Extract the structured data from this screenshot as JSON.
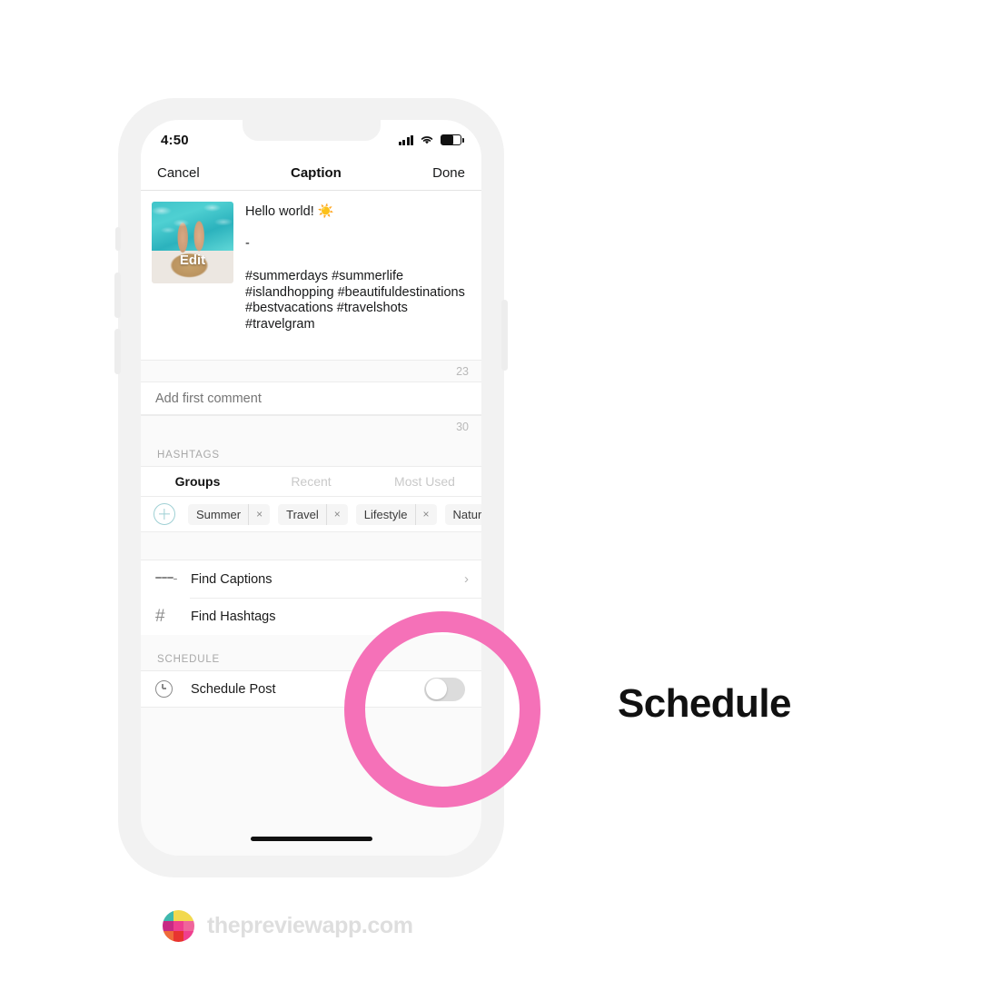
{
  "status_bar": {
    "time": "4:50",
    "icons": [
      "signal-icon",
      "wifi-icon",
      "battery-icon"
    ],
    "battery_level_pct": 60
  },
  "nav_bar": {
    "cancel_label": "Cancel",
    "title": "Caption",
    "done_label": "Done"
  },
  "caption": {
    "thumbnail_overlay_label": "Edit",
    "line1": "Hello world! ☀️",
    "dash": "-",
    "hashtags": " #summerdays #summerlife\n#islandhopping #beautifuldestinations\n#bestvacations #travelshots\n#travelgram",
    "char_counter": "23"
  },
  "comment": {
    "placeholder": "Add first comment",
    "value": "",
    "char_counter": "30"
  },
  "hashtags_section": {
    "header": "HASHTAGS",
    "tabs": [
      {
        "label": "Groups",
        "active": true
      },
      {
        "label": "Recent",
        "active": false
      },
      {
        "label": "Most Used",
        "active": false
      }
    ],
    "add_icon": "plus-circle-icon",
    "chips": [
      {
        "label": "Summer",
        "remove": "×"
      },
      {
        "label": "Travel",
        "remove": "×"
      },
      {
        "label": "Lifestyle",
        "remove": "×"
      },
      {
        "label": "Nature",
        "remove": "×"
      }
    ]
  },
  "menu": {
    "rows": [
      {
        "label": "Find Captions",
        "icon": "lines-icon",
        "chevron": "›"
      },
      {
        "label": "Find Hashtags",
        "icon": "hash-icon",
        "chevron": ""
      }
    ]
  },
  "schedule_section": {
    "header": "SCHEDULE",
    "row_label": "Schedule Post",
    "row_icon": "clock-icon",
    "toggle_state": "off"
  },
  "annotation": {
    "title": "Schedule",
    "highlight_color": "#f571b8"
  },
  "footer": {
    "url": "thepreviewapp.com",
    "logo_colors": [
      "#3fb8ae",
      "#f2d94e",
      "#f2d94e",
      "#c72a85",
      "#ef3f8f",
      "#f0659b",
      "#ef6b3a",
      "#e8342f",
      "#ef3f8f"
    ]
  }
}
